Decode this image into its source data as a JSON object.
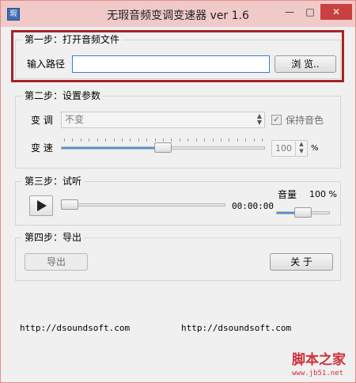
{
  "window": {
    "title": "无瑕音频变调变速器 ver 1.6",
    "icon_label": "瑕",
    "min_label": "—",
    "max_label": "□",
    "close_label": "✕"
  },
  "step1": {
    "title": "第一步：打开音频文件",
    "path_label": "输入路径",
    "path_value": "",
    "browse_label": "浏 览.."
  },
  "step2": {
    "title": "第二步：设置参数",
    "tone_label": "变 调",
    "tone_value": "不变",
    "keep_tone_label": "保持音色",
    "keep_tone_checked": true,
    "speed_label": "变 速",
    "speed_value": "100",
    "speed_unit": "%",
    "speed_slider_fraction": 0.5
  },
  "step3": {
    "title": "第三步：试听",
    "time": "00:00:00",
    "volume_label": "音量",
    "volume_value": "100 %",
    "progress_fraction": 0.0,
    "volume_fraction": 0.5
  },
  "step4": {
    "title": "第四步：导出",
    "export_label": "导出",
    "close_label": "关 于"
  },
  "footer": {
    "link1": "http://dsoundsoft.com",
    "link2": "http://dsoundsoft.com"
  },
  "watermark": {
    "main": "脚本之家",
    "sub": "www.jb51.net"
  },
  "colors": {
    "titlebar": "#f0c9c9",
    "highlight": "#a8222a",
    "accent": "#4a90d9",
    "watermark": "#d0303a"
  }
}
